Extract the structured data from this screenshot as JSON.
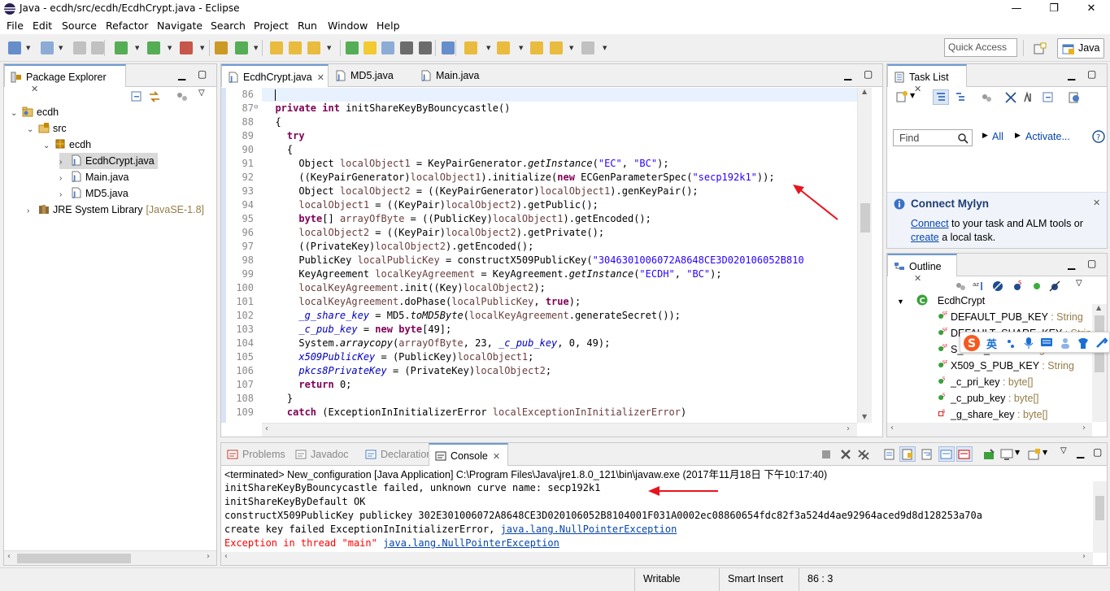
{
  "window": {
    "title": "Java - ecdh/src/ecdh/EcdhCrypt.java - Eclipse"
  },
  "menu": [
    "File",
    "Edit",
    "Source",
    "Refactor",
    "Navigate",
    "Search",
    "Project",
    "Run",
    "Window",
    "Help"
  ],
  "toolbar": {
    "quick_access": "Quick Access",
    "perspective": "Java"
  },
  "package_explorer": {
    "tab": "Package Explorer",
    "items": [
      {
        "label": "ecdh",
        "depth": 0,
        "icon": "project-icon",
        "expanded": true
      },
      {
        "label": "src",
        "depth": 1,
        "icon": "source-folder-icon",
        "expanded": true
      },
      {
        "label": "ecdh",
        "depth": 2,
        "icon": "package-icon",
        "expanded": true
      },
      {
        "label": "EcdhCrypt.java",
        "depth": 3,
        "icon": "java-file-icon",
        "selected": true
      },
      {
        "label": "Main.java",
        "depth": 3,
        "icon": "java-file-icon"
      },
      {
        "label": "MD5.java",
        "depth": 3,
        "icon": "java-file-icon"
      },
      {
        "label": "JRE System Library",
        "suffix": "[JavaSE-1.8]",
        "depth": 1,
        "icon": "library-icon"
      }
    ]
  },
  "editor": {
    "tabs": [
      "EcdhCrypt.java",
      "MD5.java",
      "Main.java"
    ],
    "lines": [
      {
        "n": "86",
        "html": ""
      },
      {
        "n": "87",
        "html": "  <span class='kw'>private</span> <span class='kw'>int</span> initShareKeyByBouncycastle()"
      },
      {
        "n": "88",
        "html": "  {"
      },
      {
        "n": "89",
        "html": "    <span class='kw'>try</span>"
      },
      {
        "n": "90",
        "html": "    {"
      },
      {
        "n": "91",
        "html": "      Object <span class='var'>localObject1</span> = KeyPairGenerator.<span class='it'>getInstance</span>(<span class='str'>\"EC\"</span>, <span class='str'>\"BC\"</span>);"
      },
      {
        "n": "92",
        "html": "      ((KeyPairGenerator)<span class='var'>localObject1</span>).initialize(<span class='kw'>new</span> ECGenParameterSpec(<span class='str'>\"secp192k1\"</span>));"
      },
      {
        "n": "93",
        "html": "      Object <span class='var'>localObject2</span> = ((KeyPairGenerator)<span class='var'>localObject1</span>).genKeyPair();"
      },
      {
        "n": "94",
        "html": "      <span class='var'>localObject1</span> = ((KeyPair)<span class='var'>localObject2</span>).getPublic();"
      },
      {
        "n": "95",
        "html": "      <span class='kw'>byte</span>[] <span class='var'>arrayOfByte</span> = ((PublicKey)<span class='var'>localObject1</span>).getEncoded();"
      },
      {
        "n": "96",
        "html": "      <span class='var'>localObject2</span> = ((KeyPair)<span class='var'>localObject2</span>).getPrivate();"
      },
      {
        "n": "97",
        "html": "      ((PrivateKey)<span class='var'>localObject2</span>).getEncoded();"
      },
      {
        "n": "98",
        "html": "      PublicKey <span class='var'>localPublicKey</span> = constructX509PublicKey(<span class='str'>\"3046301006072A8648CE3D020106052B810</span>"
      },
      {
        "n": "99",
        "html": "      KeyAgreement <span class='var'>localKeyAgreement</span> = KeyAgreement.<span class='it'>getInstance</span>(<span class='str'>\"ECDH\"</span>, <span class='str'>\"BC\"</span>);"
      },
      {
        "n": "100",
        "html": "      <span class='var'>localKeyAgreement</span>.init((Key)<span class='var'>localObject2</span>);"
      },
      {
        "n": "101",
        "html": "      <span class='var'>localKeyAgreement</span>.doPhase(<span class='var'>localPublicKey</span>, <span class='kw'>true</span>);"
      },
      {
        "n": "102",
        "html": "      <span class='fld it'>_g_share_key</span> = MD5.<span class='it'>toMD5Byte</span>(<span class='var'>localKeyAgreement</span>.generateSecret());"
      },
      {
        "n": "103",
        "html": "      <span class='fld it'>_c_pub_key</span> = <span class='kw'>new</span> <span class='kw'>byte</span>[49];"
      },
      {
        "n": "104",
        "html": "      System.<span class='it'>arraycopy</span>(<span class='var'>arrayOfByte</span>, 23, <span class='fld it'>_c_pub_key</span>, 0, 49);"
      },
      {
        "n": "105",
        "html": "      <span class='fld it'>x509PublicKey</span> = (PublicKey)<span class='var'>localObject1</span>;"
      },
      {
        "n": "106",
        "html": "      <span class='fld it'>pkcs8PrivateKey</span> = (PrivateKey)<span class='var'>localObject2</span>;"
      },
      {
        "n": "107",
        "html": "      <span class='kw'>return</span> 0;"
      },
      {
        "n": "108",
        "html": "    }"
      },
      {
        "n": "109",
        "html": "    <span class='kw'>catch</span> (ExceptionInInitializerError <span class='var'>localExceptionInInitializerError</span>)"
      }
    ]
  },
  "task_list": {
    "tab": "Task List",
    "find_placeholder": "Find",
    "all": "All",
    "activate": "Activate..."
  },
  "mylyn": {
    "title": "Connect Mylyn",
    "connect": "Connect",
    "text1": " to your task and ALM tools or",
    "create": "create",
    "text2": " a local task."
  },
  "outline": {
    "tab": "Outline",
    "root": "EcdhCrypt",
    "items": [
      {
        "name": "DEFAULT_PUB_KEY",
        "type": " : String",
        "mod": "SF"
      },
      {
        "name": "DEFAULT_SHARE_KEY",
        "type": " : String",
        "mod": "SF"
      },
      {
        "name": "S_PUB_KEY",
        "type": " : String",
        "mod": "SF"
      },
      {
        "name": "X509_S_PUB_KEY",
        "type": " : String",
        "mod": "SF"
      },
      {
        "name": "_c_pri_key",
        "type": " : byte[]",
        "mod": "S"
      },
      {
        "name": "_c_pub_key",
        "type": " : byte[]",
        "mod": "S"
      },
      {
        "name": "_g_share_key",
        "type": " : byte[]",
        "mod": "S"
      }
    ]
  },
  "ime": {
    "label": "英"
  },
  "bottom": {
    "tabs": [
      "Problems",
      "Javadoc",
      "Declaration",
      "Console"
    ],
    "terminated": "<terminated> New_configuration [Java Application] C:\\Program Files\\Java\\jre1.8.0_121\\bin\\javaw.exe (2017年11月18日 下午10:17:40)",
    "lines": [
      {
        "text": "initShareKeyByBouncycastle failed, unknown curve name: secp192k1",
        "err": false
      },
      {
        "text": "initShareKeyByDefault OK",
        "err": false
      },
      {
        "text": "constructX509PublicKey publickey 302E301006072A8648CE3D020106052B8104001F031A0002ec08860654fdc82f3a524d4ae92964aced9d8d128253a70a",
        "err": false
      },
      {
        "text": "create key failed ExceptionInInitializerError, ",
        "err": false,
        "link": "java.lang.NullPointerException"
      },
      {
        "text": "Exception in thread \"main\" ",
        "err": true,
        "link": "java.lang.NullPointerException"
      }
    ]
  },
  "status": {
    "writable": "Writable",
    "insert": "Smart Insert",
    "position": "86 : 3"
  },
  "colors": {
    "annotation_arrow": "#e8141e",
    "accent": "#6e9ad4"
  }
}
